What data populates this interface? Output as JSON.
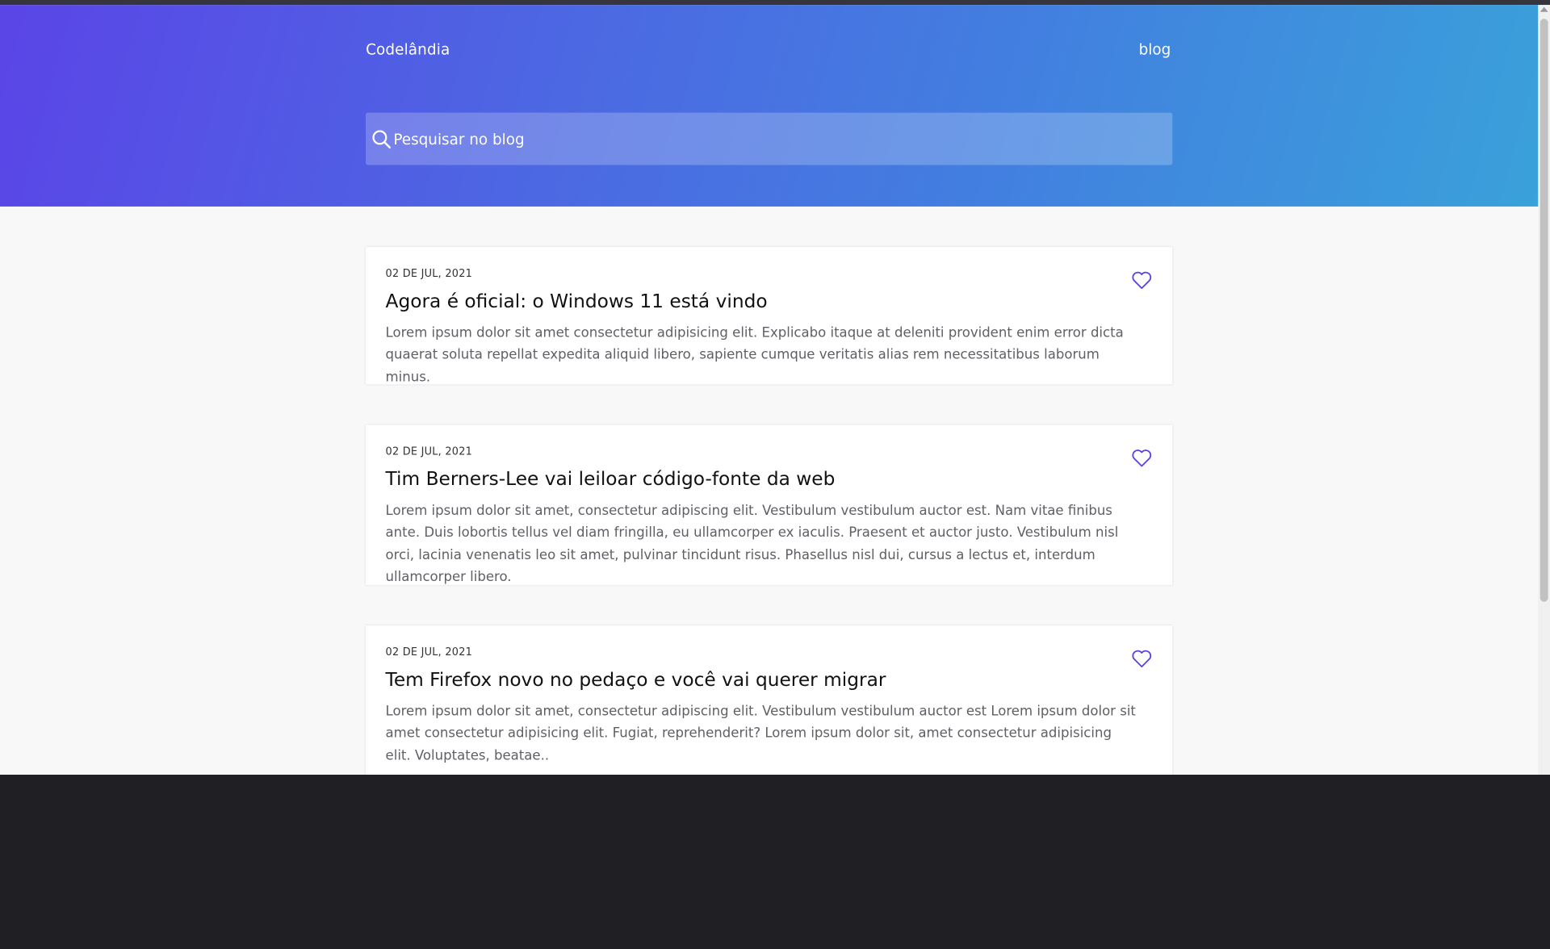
{
  "header": {
    "logo": "Codelândia",
    "nav_link": "blog"
  },
  "search": {
    "placeholder": "Pesquisar no blog",
    "icon": "search-icon"
  },
  "posts": [
    {
      "date": "02 DE JUL, 2021",
      "title": "Agora é oficial: o Windows 11 está vindo",
      "description": "Lorem ipsum dolor sit amet consectetur adipisicing elit. Explicabo itaque at deleniti provident enim error dicta quaerat soluta repellat expedita aliquid libero, sapiente cumque veritatis alias rem necessitatibus laborum minus.",
      "icon": "heart-icon"
    },
    {
      "date": "02 DE JUL, 2021",
      "title": "Tim Berners-Lee vai leiloar código-fonte da web",
      "description": "Lorem ipsum dolor sit amet, consectetur adipiscing elit. Vestibulum vestibulum auctor est. Nam vitae finibus ante. Duis lobortis tellus vel diam fringilla, eu ullamcorper ex iaculis. Praesent et auctor justo. Vestibulum nisl orci, lacinia venenatis leo sit amet, pulvinar tincidunt risus. Phasellus nisl dui, cursus a lectus et, interdum ullamcorper libero.",
      "icon": "heart-icon"
    },
    {
      "date": "02 DE JUL, 2021",
      "title": "Tem Firefox novo no pedaço e você vai querer migrar",
      "description": "Lorem ipsum dolor sit amet, consectetur adipiscing elit. Vestibulum vestibulum auctor est Lorem ipsum dolor sit amet consectetur adipisicing elit. Fugiat, reprehenderit? Lorem ipsum dolor sit, amet consectetur adipisicing elit. Voluptates, beatae..",
      "icon": "heart-icon"
    }
  ],
  "colors": {
    "gradient_start": "#5a45e7",
    "gradient_end": "#3aa1da",
    "heart": "#5b3fe0",
    "background": "#f8f8f8"
  }
}
